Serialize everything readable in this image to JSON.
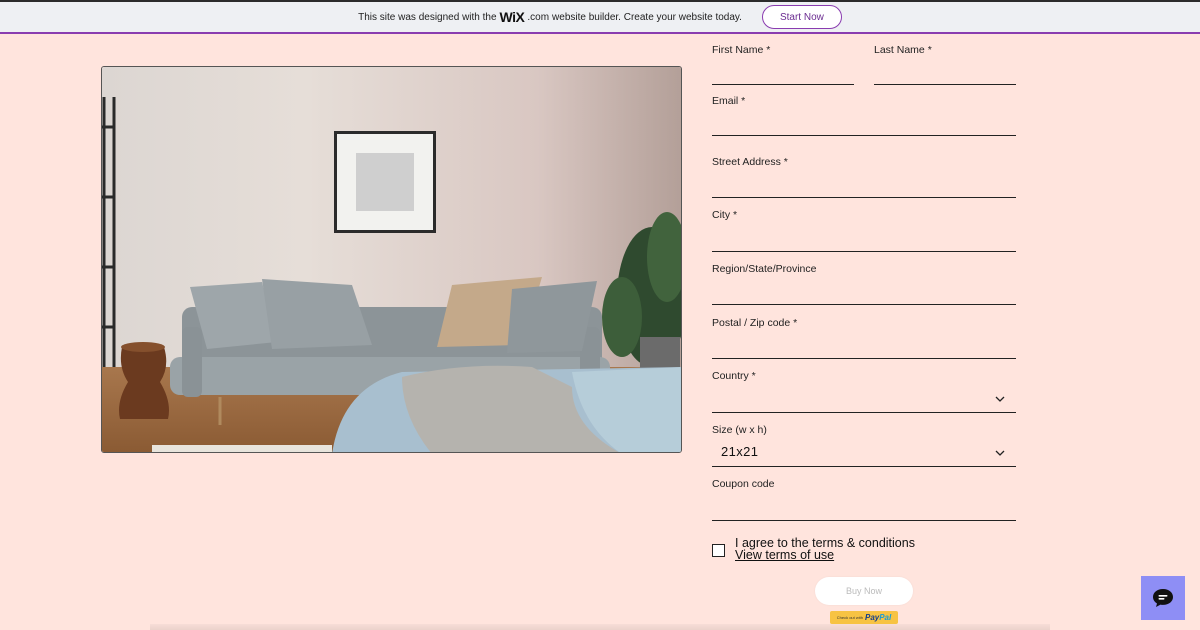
{
  "banner": {
    "prefix": "This site was designed with the",
    "wix_logo": "WiX",
    "wix_suffix": ".com",
    "suffix": "website builder. Create your website today.",
    "cta": "Start Now"
  },
  "form": {
    "first_name_label": "First Name *",
    "last_name_label": "Last Name *",
    "email_label": "Email *",
    "street_label": "Street Address *",
    "city_label": "City *",
    "region_label": "Region/State/Province",
    "postal_label": "Postal / Zip code *",
    "country_label": "Country *",
    "size_label": "Size (w x h)",
    "size_value": "21x21",
    "coupon_label": "Coupon code",
    "agree_text": "I agree to the terms & conditions",
    "terms_link": "View terms of use",
    "buy_button": "Buy Now",
    "paypal_prefix": "Check out with",
    "paypal_logo_a": "Pay",
    "paypal_logo_b": "Pal"
  },
  "icons": {
    "chevron": "chevron-down-icon",
    "chat": "chat-bubble-icon"
  },
  "colors": {
    "background": "#ffe4dd",
    "banner_accent": "#8a3cb0",
    "chat_button": "#8e8ef5",
    "paypal": "#f7c343"
  }
}
